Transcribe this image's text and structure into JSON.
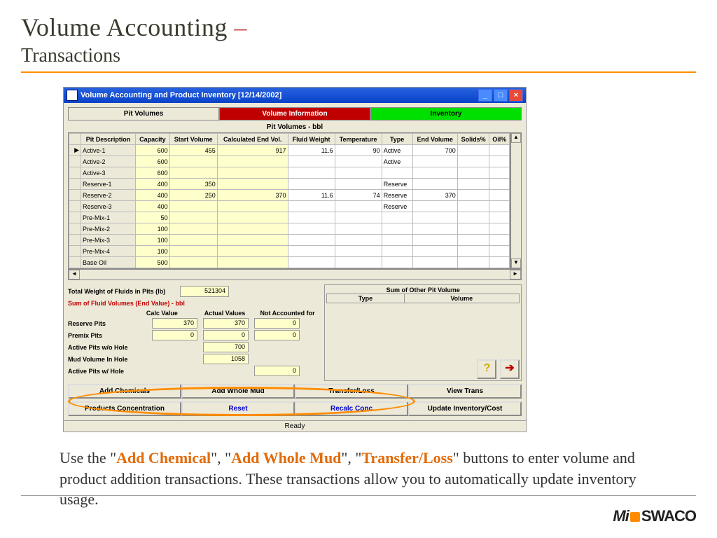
{
  "slide": {
    "title": "Volume Accounting",
    "dash": " –",
    "subtitle": "Transactions",
    "caption_parts": {
      "p1": "Use the \"",
      "b1": "Add Chemical",
      "p2": "\", \"",
      "b2": "Add Whole Mud",
      "p3": "\", \"",
      "b3": "Transfer/Loss",
      "p4": "\" buttons to enter volume and product addition transactions.  These transactions allow you to automatically update inventory usage."
    },
    "logo": {
      "mi": "Mi",
      "swaco": "SWACO"
    }
  },
  "window": {
    "title": "Volume Accounting and Product Inventory [12/14/2002]",
    "tabs": {
      "pit": "Pit Volumes",
      "vol": "Volume Information",
      "inv": "Inventory"
    },
    "panel_title": "Pit Volumes - bbl",
    "columns": [
      "Pit Description",
      "Capacity",
      "Start Volume",
      "Calculated End Vol.",
      "Fluid Weight",
      "Temperature",
      "Type",
      "End Volume",
      "Solids%",
      "Oil%"
    ],
    "rows": [
      {
        "desc": "Active-1",
        "cap": "600",
        "start": "455",
        "calc": "917",
        "fw": "11.6",
        "temp": "90",
        "type": "Active",
        "end": "700",
        "sol": "",
        "oil": ""
      },
      {
        "desc": "Active-2",
        "cap": "600",
        "start": "",
        "calc": "",
        "fw": "",
        "temp": "",
        "type": "Active",
        "end": "",
        "sol": "",
        "oil": ""
      },
      {
        "desc": "Active-3",
        "cap": "600",
        "start": "",
        "calc": "",
        "fw": "",
        "temp": "",
        "type": "",
        "end": "",
        "sol": "",
        "oil": ""
      },
      {
        "desc": "Reserve-1",
        "cap": "400",
        "start": "350",
        "calc": "",
        "fw": "",
        "temp": "",
        "type": "Reserve",
        "end": "",
        "sol": "",
        "oil": ""
      },
      {
        "desc": "Reserve-2",
        "cap": "400",
        "start": "250",
        "calc": "370",
        "fw": "11.6",
        "temp": "74",
        "type": "Reserve",
        "end": "370",
        "sol": "",
        "oil": ""
      },
      {
        "desc": "Reserve-3",
        "cap": "400",
        "start": "",
        "calc": "",
        "fw": "",
        "temp": "",
        "type": "Reserve",
        "end": "",
        "sol": "",
        "oil": ""
      },
      {
        "desc": "Pre-Mix-1",
        "cap": "50",
        "start": "",
        "calc": "",
        "fw": "",
        "temp": "",
        "type": "",
        "end": "",
        "sol": "",
        "oil": ""
      },
      {
        "desc": "Pre-Mix-2",
        "cap": "100",
        "start": "",
        "calc": "",
        "fw": "",
        "temp": "",
        "type": "",
        "end": "",
        "sol": "",
        "oil": ""
      },
      {
        "desc": "Pre-Mix-3",
        "cap": "100",
        "start": "",
        "calc": "",
        "fw": "",
        "temp": "",
        "type": "",
        "end": "",
        "sol": "",
        "oil": ""
      },
      {
        "desc": "Pre-Mix-4",
        "cap": "100",
        "start": "",
        "calc": "",
        "fw": "",
        "temp": "",
        "type": "",
        "end": "",
        "sol": "",
        "oil": ""
      },
      {
        "desc": "Base Oil",
        "cap": "500",
        "start": "",
        "calc": "",
        "fw": "",
        "temp": "",
        "type": "",
        "end": "",
        "sol": "",
        "oil": ""
      }
    ],
    "total_weight_label": "Total Weight of Fluids in Pits (lb)",
    "total_weight_value": "521304",
    "sum_title": "Sum of Fluid Volumes (End Value) - bbl",
    "calc_headers": {
      "c1": "Calc Value",
      "c2": "Actual Values",
      "c3": "Not Accounted for"
    },
    "calc_rows": [
      {
        "lbl": "Reserve Pits",
        "c1": "370",
        "c2": "370",
        "c3": "0"
      },
      {
        "lbl": "Premix Pits",
        "c1": "0",
        "c2": "0",
        "c3": "0"
      },
      {
        "lbl": "Active Pits w/o Hole",
        "c1": "",
        "c2": "700",
        "c3": ""
      },
      {
        "lbl": "Mud Volume In Hole",
        "c1": "",
        "c2": "1058",
        "c3": ""
      },
      {
        "lbl": "Active Pits w/ Hole",
        "c1": "",
        "c2": "",
        "c3": "0"
      }
    ],
    "other_pit": {
      "title": "Sum of Other Pit Volume",
      "cols": {
        "type": "Type",
        "vol": "Volume"
      }
    },
    "buttons": {
      "row1": {
        "a": "Add Chemicals",
        "b": "Add Whole Mud",
        "c": "Transfer/Loss",
        "d": "View Trans"
      },
      "row2": {
        "a": "Products Concentration",
        "b": "Reset",
        "c": "Recalc Conc",
        "d": "Update Inventory/Cost"
      }
    },
    "status": "Ready",
    "icons": {
      "help": "?",
      "exit": "➔"
    }
  }
}
